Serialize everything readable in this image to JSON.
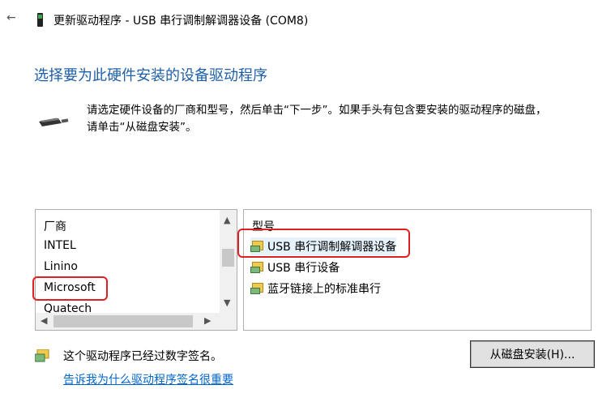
{
  "window": {
    "back_glyph": "←",
    "title": "更新驱动程序 - USB 串行调制解调器设备 (COM8)"
  },
  "heading": "选择要为此硬件安装的设备驱动程序",
  "instruction": {
    "line1": "请选定硬件设备的厂商和型号，然后单击“下一步”。如果手头有包含要安装的驱动程序的磁盘，",
    "line2": "请单击“从磁盘安装”。"
  },
  "manufacturer_list": {
    "header": "厂商",
    "items": [
      "INTEL",
      "Linino",
      "Microsoft",
      "Quatech"
    ],
    "highlighted": "Microsoft"
  },
  "model_list": {
    "header": "型号",
    "items": [
      "USB 串行调制解调器设备",
      "USB 串行设备",
      "蓝牙链接上的标准串行"
    ],
    "selected": "USB 串行调制解调器设备"
  },
  "signature": {
    "text": "这个驱动程序已经过数字签名。",
    "link": "告诉我为什么驱动程序签名很重要"
  },
  "buttons": {
    "have_disk": "从磁盘安装(H)..."
  },
  "colors": {
    "heading": "#1f5fa8",
    "link": "#0066cc",
    "highlight": "#e02020",
    "selection": "#e5f1fb"
  },
  "icons": {
    "back": "back-arrow-icon",
    "title": "device-manager-icon",
    "device": "modem-cable-icon",
    "driver": "driver-icon",
    "signature": "signed-driver-icon"
  }
}
